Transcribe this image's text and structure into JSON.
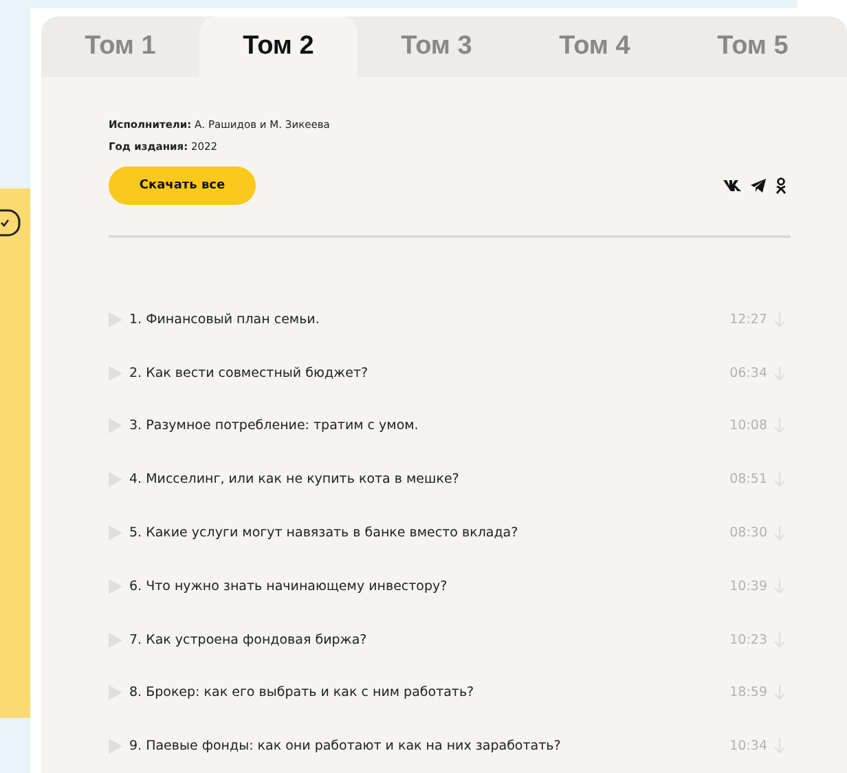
{
  "tabs": [
    {
      "label": "Том 1",
      "selected": false
    },
    {
      "label": "Том 2",
      "selected": true
    },
    {
      "label": "Том 3",
      "selected": false
    },
    {
      "label": "Том 4",
      "selected": false
    },
    {
      "label": "Том 5",
      "selected": false
    }
  ],
  "info": [
    {
      "label": "Исполнители:",
      "value": "А. Рашидов и М. Зикеева"
    },
    {
      "label": "Год издания:",
      "value": "2022"
    }
  ],
  "download_all_button": "Скачать все",
  "tracks": [
    {
      "title": "1. Финансовый план семьи.",
      "duration": "12:27"
    },
    {
      "title": "2. Как вести совместный бюджет?",
      "duration": "06:34"
    },
    {
      "title": "3. Разумное потребление: тратим с умом.",
      "duration": "10:08"
    },
    {
      "title": "4. Мисселинг, или как не купить кота в мешке?",
      "duration": "08:51"
    },
    {
      "title": "5. Какие услуги могут навязать в банке вместо вклада?",
      "duration": "08:30"
    },
    {
      "title": "6. Что нужно знать начинающему инвестору?",
      "duration": "10:39"
    },
    {
      "title": "7. Как устроена фондовая биржа?",
      "duration": "10:23"
    },
    {
      "title": "8. Брокер: как его выбрать и как с ним работать?",
      "duration": "18:59"
    },
    {
      "title": "9. Паевые фонды: как они работают и как на них заработать?",
      "duration": "10:34"
    }
  ]
}
